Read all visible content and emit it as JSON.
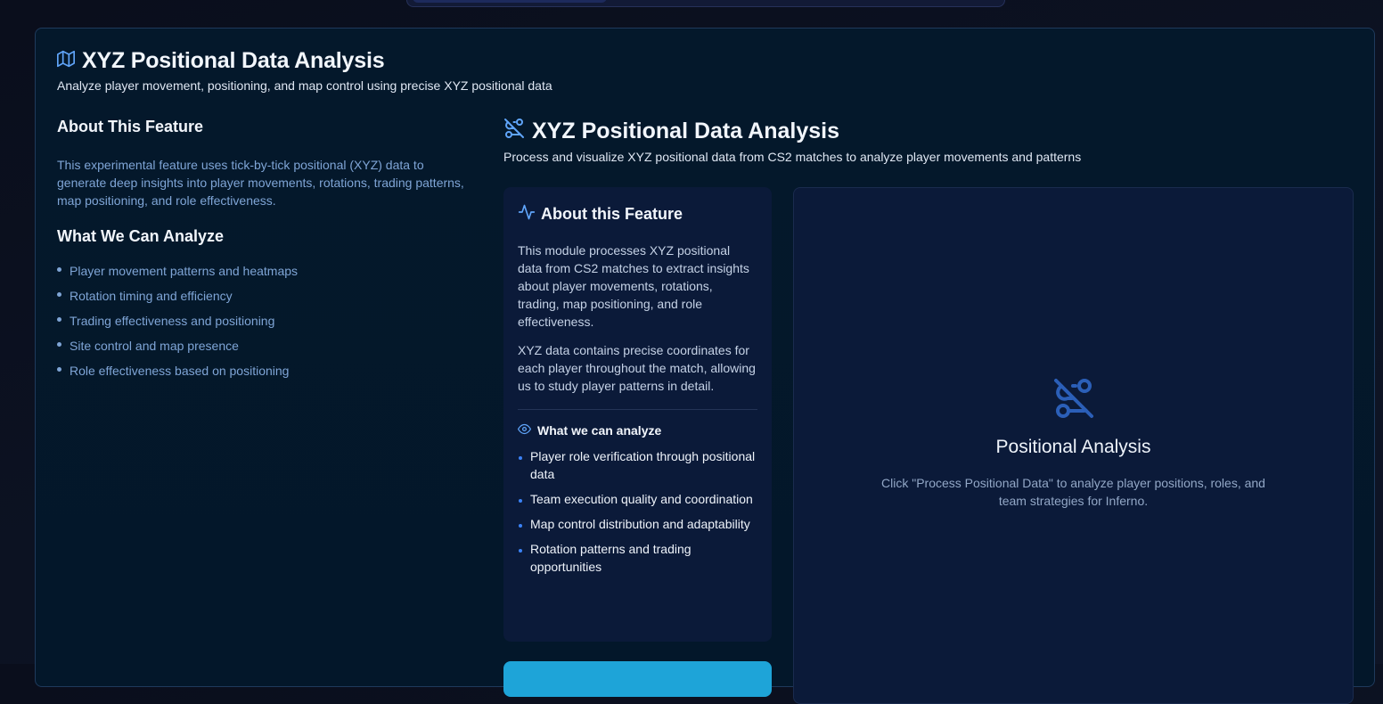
{
  "header": {
    "title": "XYZ Positional Data Analysis",
    "subtitle": "Analyze player movement, positioning, and map control using precise XYZ positional data"
  },
  "about": {
    "heading": "About This Feature",
    "description": "This experimental feature uses tick-by-tick positional (XYZ) data to generate deep insights into player movements, rotations, trading patterns, map positioning, and role effectiveness.",
    "analyze_heading": "What We Can Analyze",
    "items": [
      "Player movement patterns and heatmaps",
      "Rotation timing and efficiency",
      "Trading effectiveness and positioning",
      "Site control and map presence",
      "Role effectiveness based on positioning"
    ]
  },
  "module": {
    "title": "XYZ Positional Data Analysis",
    "subtitle": "Process and visualize XYZ positional data from CS2 matches to analyze player movements and patterns",
    "about_panel": {
      "title": "About this Feature",
      "para1": "This module processes XYZ positional data from CS2 matches to extract insights about player movements, rotations, trading, map positioning, and role effectiveness.",
      "para2": "XYZ data contains precise coordinates for each player throughout the match, allowing us to study player patterns in detail.",
      "analyze_title": "What we can analyze",
      "items": [
        "Player role verification through positional data",
        "Team execution quality and coordination",
        "Map control distribution and adaptability",
        "Rotation patterns and trading opportunities"
      ]
    },
    "empty_state": {
      "title": "Positional Analysis",
      "text": "Click \"Process Positional Data\" to analyze player positions, roles, and team strategies for Inferno."
    }
  },
  "icons": {
    "header": "map-icon",
    "module": "route-off-icon",
    "about_panel": "activity-icon",
    "analyze": "eye-icon",
    "empty_state": "route-off-icon"
  },
  "colors": {
    "accent_blue": "#3b82f6",
    "muted_text": "#7fa5d6",
    "button": "#1ea4d8"
  }
}
